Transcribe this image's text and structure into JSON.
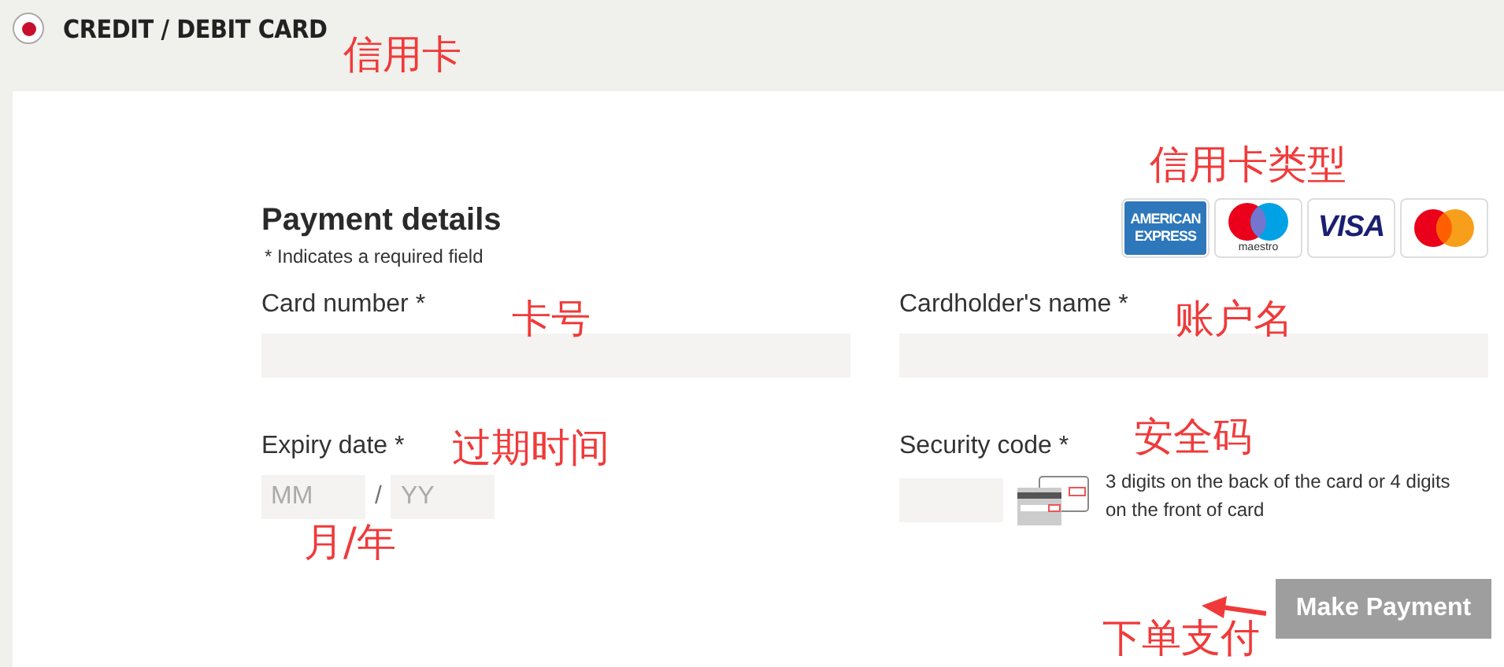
{
  "header": {
    "title": "CREDIT / DEBIT CARD",
    "radio_selected": true
  },
  "form": {
    "title": "Payment details",
    "note": "* Indicates a required field",
    "card_number": {
      "label": "Card number *"
    },
    "cardholder": {
      "label": "Cardholder's name *"
    },
    "expiry": {
      "label": "Expiry date *",
      "month": {
        "placeholder": "MM"
      },
      "separator": "/",
      "year": {
        "placeholder": "YY"
      }
    },
    "security": {
      "label": "Security code *",
      "help": "3 digits on the back of the card or 4 digits on the front of card"
    },
    "submit": "Make Payment"
  },
  "card_logos": [
    {
      "kind": "amex",
      "text": "AMERICAN EXPRESS"
    },
    {
      "kind": "maestro",
      "text": "maestro"
    },
    {
      "kind": "visa",
      "text": "VISA"
    },
    {
      "kind": "mastercard"
    }
  ],
  "annotations": [
    {
      "text": "信用卡"
    },
    {
      "text": "信用卡类型"
    },
    {
      "text": "卡号"
    },
    {
      "text": "账户名"
    },
    {
      "text": "过期时间"
    },
    {
      "text": "安全码"
    },
    {
      "text": "月/年"
    },
    {
      "text": "下单支付"
    }
  ]
}
